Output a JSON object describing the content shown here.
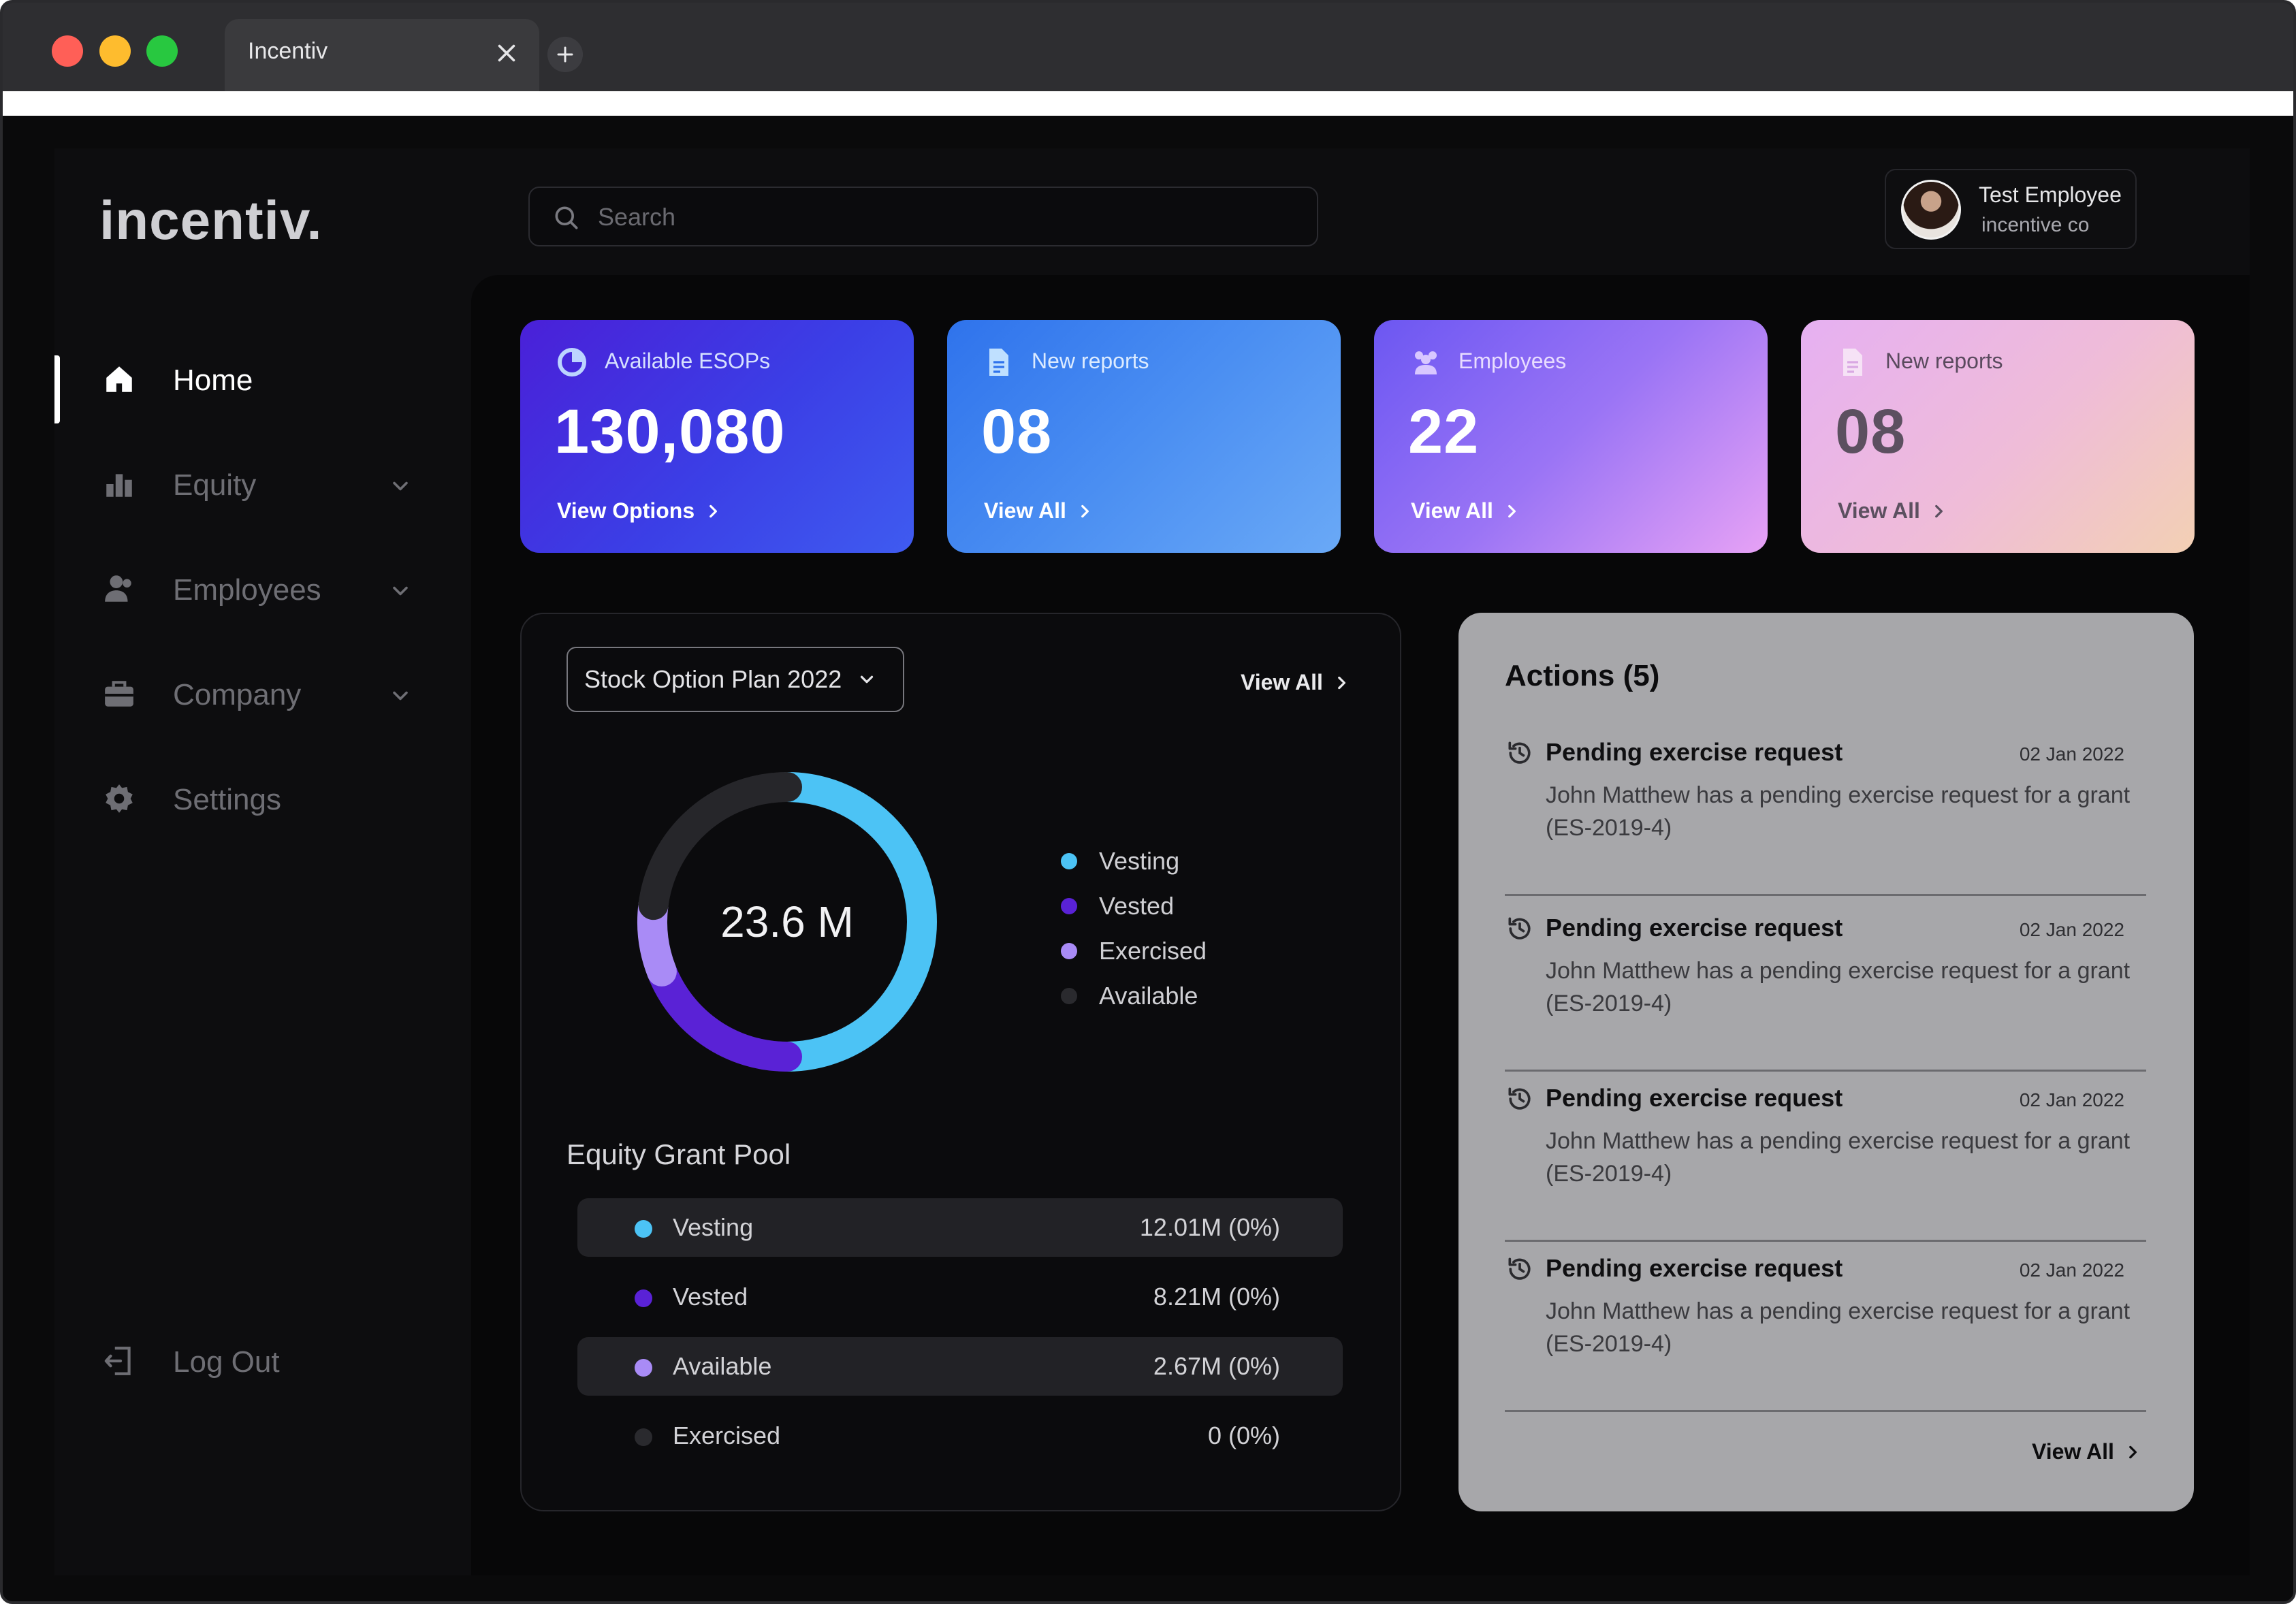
{
  "browser": {
    "tab_title": "Incentiv"
  },
  "app": {
    "logo": "incentiv.",
    "search": {
      "placeholder": "Search"
    },
    "profile": {
      "name": "Test Employee",
      "company": "incentive co"
    }
  },
  "sidebar": {
    "items": [
      {
        "label": "Home",
        "icon": "home-icon",
        "active": true
      },
      {
        "label": "Equity",
        "icon": "bar-chart-icon",
        "expandable": true
      },
      {
        "label": "Employees",
        "icon": "users-icon",
        "expandable": true
      },
      {
        "label": "Company",
        "icon": "briefcase-icon",
        "expandable": true
      },
      {
        "label": "Settings",
        "icon": "gear-icon"
      }
    ],
    "logout": {
      "label": "Log Out",
      "icon": "logout-icon"
    }
  },
  "stats": [
    {
      "label": "Available ESOPs",
      "value": "130,080",
      "link": "View Options",
      "icon": "pie-chart-icon"
    },
    {
      "label": "New reports",
      "value": "08",
      "link": "View All",
      "icon": "document-icon"
    },
    {
      "label": "Employees",
      "value": "22",
      "link": "View All",
      "icon": "users-icon"
    },
    {
      "label": "New reports",
      "value": "08",
      "link": "View All",
      "icon": "document-icon"
    }
  ],
  "equity_panel": {
    "plan_select": "Stock Option Plan 2022",
    "view_all": "View All",
    "donut_center": "23.6 M",
    "legend": [
      {
        "label": "Vesting",
        "color": "#4cc3f5"
      },
      {
        "label": "Vested",
        "color": "#5a22d6"
      },
      {
        "label": "Exercised",
        "color": "#a98bf6"
      },
      {
        "label": "Available",
        "color": "#2a2a2e"
      }
    ],
    "donut_segments": [
      {
        "label": "Vesting",
        "fraction": 0.5,
        "color": "#4cc3f5"
      },
      {
        "label": "Vested",
        "fraction": 0.19,
        "color": "#5a22d6"
      },
      {
        "label": "Exercised",
        "fraction": 0.08,
        "color": "#a98bf6"
      },
      {
        "label": "Available",
        "fraction": 0.23,
        "color": "#26262a"
      }
    ],
    "pool_title": "Equity Grant Pool",
    "pool": [
      {
        "label": "Vesting",
        "value": "12.01M (0%)",
        "color": "#4cc3f5",
        "shaded": true
      },
      {
        "label": "Vested",
        "value": "8.21M (0%)",
        "color": "#5a22d6",
        "shaded": false
      },
      {
        "label": "Available",
        "value": "2.67M (0%)",
        "color": "#a98bf6",
        "shaded": true
      },
      {
        "label": "Exercised",
        "value": "0 (0%)",
        "color": "#2a2a2e",
        "shaded": false
      }
    ]
  },
  "actions": {
    "title": "Actions (5)",
    "view_all": "View All",
    "items": [
      {
        "title": "Pending exercise request",
        "date": "02 Jan 2022",
        "desc": "John Matthew has a pending exercise request for a grant (ES-2019-4)"
      },
      {
        "title": "Pending exercise request",
        "date": "02 Jan 2022",
        "desc": "John Matthew has a pending exercise request for a grant (ES-2019-4)"
      },
      {
        "title": "Pending exercise request",
        "date": "02 Jan 2022",
        "desc": "John Matthew has a pending exercise request for a grant (ES-2019-4)"
      },
      {
        "title": "Pending exercise request",
        "date": "02 Jan 2022",
        "desc": "John Matthew has a pending exercise request for a grant (ES-2019-4)"
      }
    ]
  },
  "theme": {
    "accent": "#4cc3f5",
    "background": "#0d0d0f"
  }
}
